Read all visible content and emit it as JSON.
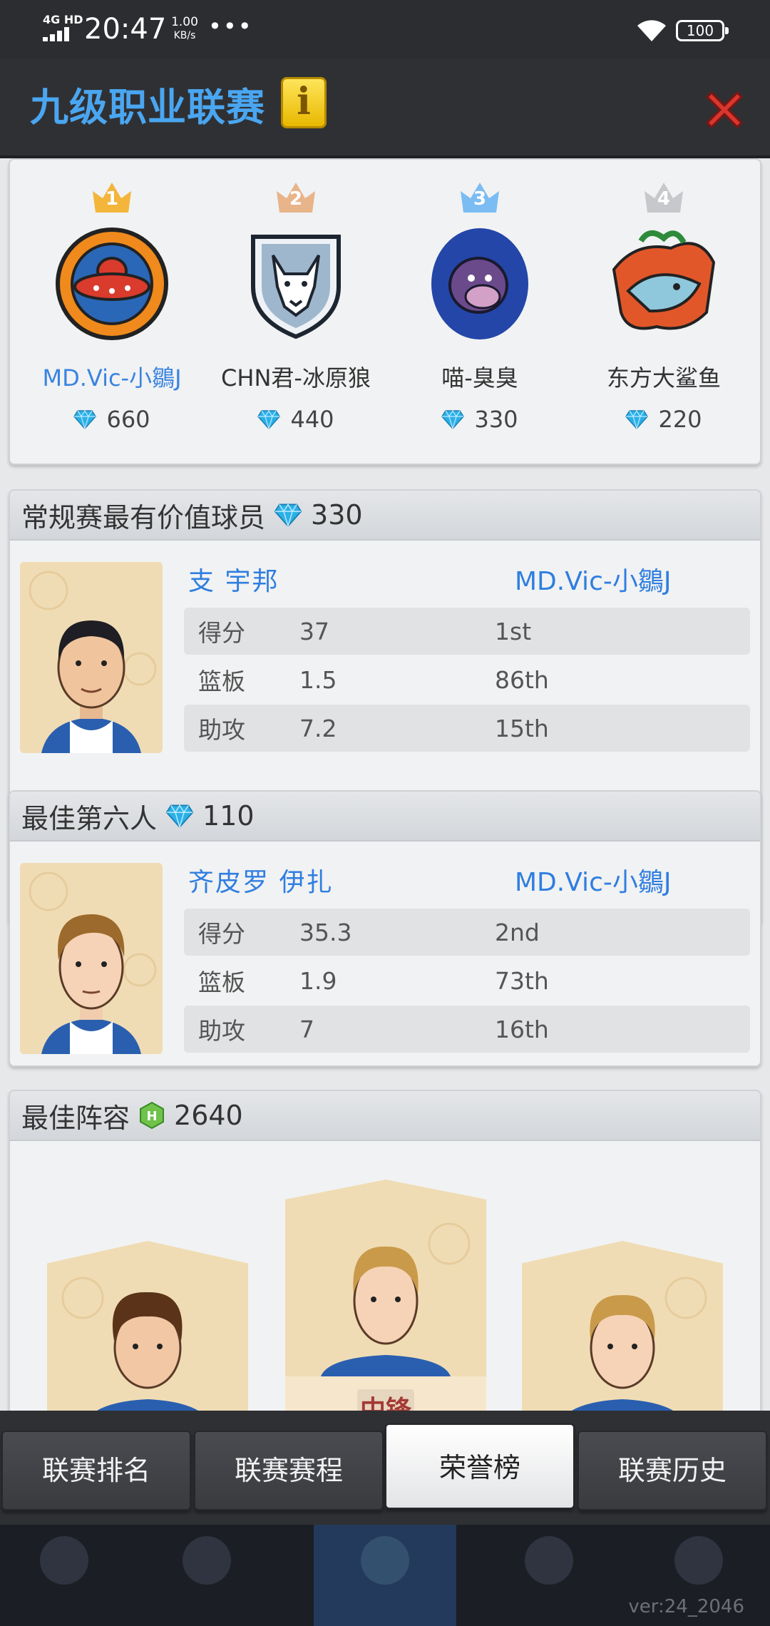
{
  "status_bar": {
    "network": "4G HD",
    "time": "20:47",
    "speed_value": "1.00",
    "speed_unit": "KB/s",
    "more": "•••",
    "battery": "100"
  },
  "header": {
    "title": "九级职业联赛",
    "info_label": "i"
  },
  "ranking": {
    "teams": [
      {
        "rank": "1",
        "name": "MD.Vic-小鶵J",
        "gems": "660",
        "crown_color": "#f3b53a",
        "highlight": true
      },
      {
        "rank": "2",
        "name": "CHN君-冰原狼",
        "gems": "440",
        "crown_color": "#e8b48a",
        "highlight": false
      },
      {
        "rank": "3",
        "name": "喵-臭臭",
        "gems": "330",
        "crown_color": "#7bbcf2",
        "highlight": false
      },
      {
        "rank": "4",
        "name": "东方大鲨鱼",
        "gems": "220",
        "crown_color": "#c6c8cb",
        "highlight": false
      }
    ]
  },
  "mvp": {
    "title": "常规赛最有价值球员",
    "points": "330",
    "player_name": "支 宇邦",
    "team": "MD.Vic-小鶵J",
    "stats": [
      {
        "label": "得分",
        "value": "37",
        "rank": "1st"
      },
      {
        "label": "篮板",
        "value": "1.5",
        "rank": "86th"
      },
      {
        "label": "助攻",
        "value": "7.2",
        "rank": "15th"
      }
    ]
  },
  "sixth_man": {
    "title": "最佳第六人",
    "points": "110",
    "player_name": "齐皮罗 伊扎",
    "team": "MD.Vic-小鶵J",
    "stats": [
      {
        "label": "得分",
        "value": "35.3",
        "rank": "2nd"
      },
      {
        "label": "篮板",
        "value": "1.9",
        "rank": "73th"
      },
      {
        "label": "助攻",
        "value": "7",
        "rank": "16th"
      }
    ]
  },
  "lineup": {
    "title": "最佳阵容",
    "points": "2640",
    "center_position": "中锋"
  },
  "tabs": [
    {
      "label": "联赛排名",
      "active": false
    },
    {
      "label": "联赛赛程",
      "active": false
    },
    {
      "label": "荣誉榜",
      "active": true
    },
    {
      "label": "联赛历史",
      "active": false
    }
  ],
  "version": "ver:24_2046"
}
